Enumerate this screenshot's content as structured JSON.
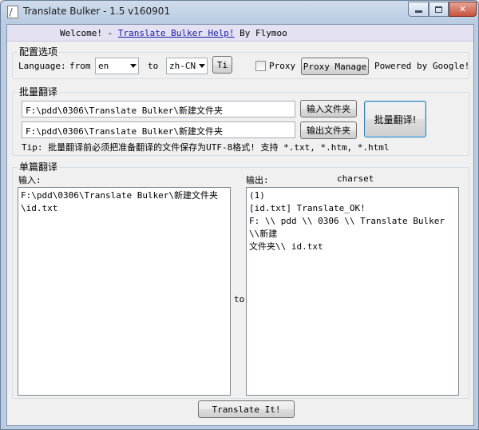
{
  "window": {
    "title": "Translate Bulker - 1.5 v160901",
    "close_glyph": "✕"
  },
  "welcome": {
    "prefix": "Welcome! - ",
    "link": "Translate Bulker Help!",
    "suffix": " By Flymoo"
  },
  "config": {
    "title": "配置选项",
    "language_label": "Language:",
    "from_label": "from",
    "from_value": "en",
    "to_label": "to",
    "to_value": "zh-CN",
    "ti_button": "Ti",
    "proxy_label": "Proxy",
    "proxy_checked": false,
    "proxy_manage_button": "Proxy Manage",
    "powered_by": "Powered by Google!"
  },
  "batch": {
    "title": "批量翻译",
    "input_folder_value": "F:\\pdd\\0306\\Translate Bulker\\新建文件夹",
    "input_folder_button": "输入文件夹",
    "output_folder_value": "F:\\pdd\\0306\\Translate Bulker\\新建文件夹",
    "output_folder_button": "输出文件夹",
    "batch_button": "批量翻译!",
    "tip": "Tip: 批量翻译前必须把准备翻译的文件保存为UTF-8格式! 支持 *.txt, *.htm, *.html"
  },
  "single": {
    "title": "单篇翻译",
    "input_label": "输入:",
    "output_label": "输出:",
    "charset_label": "charset",
    "to_label": "to",
    "input_lines": [
      "F:\\pdd\\0306\\Translate Bulker\\新建文件夹",
      "\\id.txt"
    ],
    "output_lines": [
      "(1)",
      "[id.txt] Translate_OK!",
      "F: \\\\ pdd \\\\ 0306 \\\\ Translate Bulker \\\\新建",
      "文件夹\\\\ id.txt"
    ],
    "translate_button": "Translate It!"
  }
}
